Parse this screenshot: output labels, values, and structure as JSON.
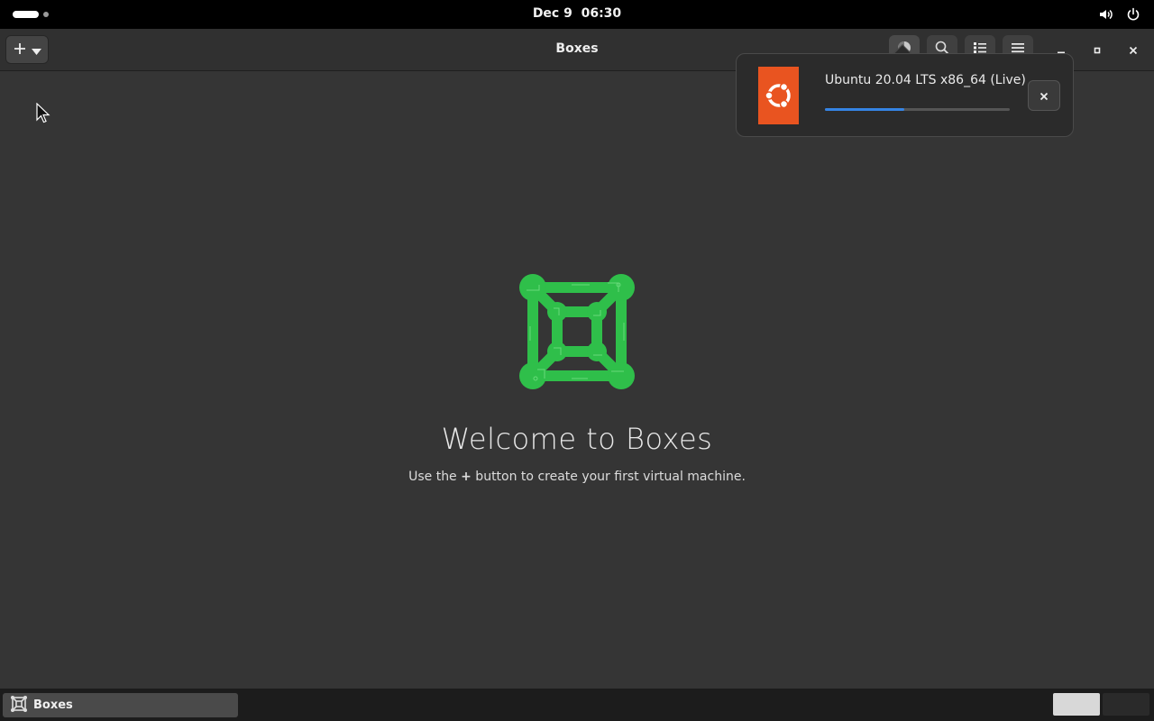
{
  "topbar": {
    "date": "Dec 9",
    "time": "06:30",
    "icons": [
      "volume-icon",
      "power-icon"
    ]
  },
  "app": {
    "title": "Boxes",
    "add_icon": "plus-icon",
    "header_icons": [
      "selection-mode-icon",
      "search-icon",
      "view-list-icon",
      "hamburger-menu-icon"
    ],
    "window_controls": [
      "minimize-icon",
      "maximize-icon",
      "close-icon"
    ]
  },
  "welcome": {
    "title": "Welcome to Boxes",
    "subtitle_before": "Use the ",
    "subtitle_plus": "+",
    "subtitle_after": " button to create your first virtual machine."
  },
  "download": {
    "name": "Ubuntu 20.04 LTS x86_64 (Live)",
    "progress": 0.43,
    "os_color": "#e95420",
    "accent": "#3584e4"
  },
  "taskbar": {
    "task_label": "Boxes"
  }
}
